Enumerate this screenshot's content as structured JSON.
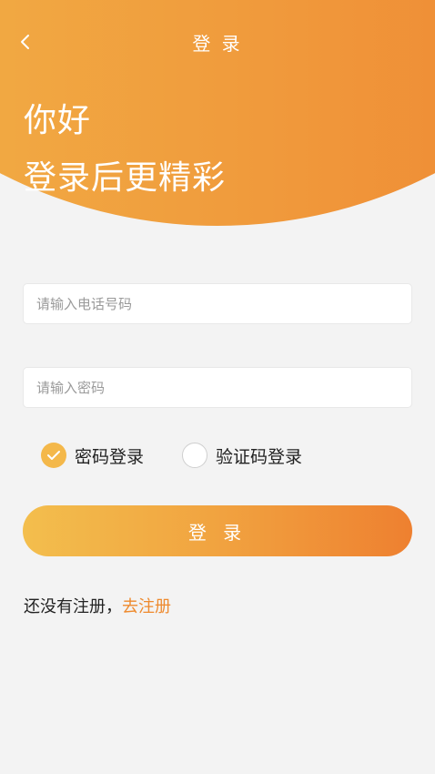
{
  "colors": {
    "accent_start": "#f2b548",
    "accent_end": "#ee8230",
    "link": "#ee8a2e",
    "background": "#f3f3f3"
  },
  "nav": {
    "back_icon": "chevron-left-icon",
    "title": "登 录"
  },
  "header": {
    "greeting_line1": "你好",
    "greeting_line2": "登录后更精彩"
  },
  "form": {
    "phone_placeholder": "请输入电话号码",
    "phone_value": "",
    "password_placeholder": "请输入密码",
    "password_value": ""
  },
  "login_mode": {
    "options": [
      {
        "label": "密码登录",
        "selected": true
      },
      {
        "label": "验证码登录",
        "selected": false
      }
    ]
  },
  "login_button": "登 录",
  "register": {
    "prompt": "还没有注册，",
    "link": "去注册"
  }
}
